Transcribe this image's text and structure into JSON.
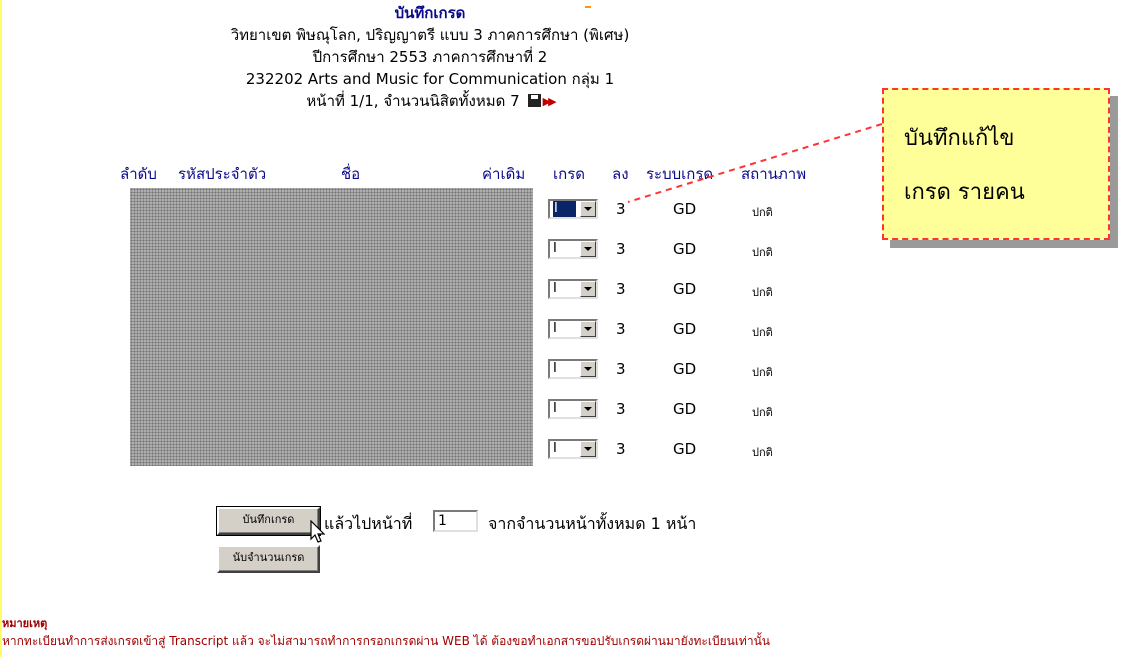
{
  "header": {
    "title": "บันทึกเกรด",
    "line1": "วิทยาเขต พิษณุโลก, ปริญญาตรี แบบ 3 ภาคการศึกษา (พิเศษ)",
    "line2": "ปีการศึกษา 2553 ภาคการศึกษาที่ 2",
    "line3": "232202 Arts and Music for Communication   กลุ่ม  1",
    "line4": "หน้าที่ 1/1, จำนวนนิสิตทั้งหมด 7",
    "icons": [
      "save-disk-icon",
      "next-page-icon"
    ]
  },
  "columns": {
    "order": "ลำดับ",
    "student_id": "รหัสประจำตัว",
    "name": "ชื่อ",
    "old_value": "ค่าเดิม",
    "grade": "เกรด",
    "credit": "ลง",
    "grade_system": "ระบบเกรด",
    "status": "สถานภาพ"
  },
  "rows": [
    {
      "grade": "I",
      "credit": "3",
      "system": "GD",
      "status": "ปกติ"
    },
    {
      "grade": "I",
      "credit": "3",
      "system": "GD",
      "status": "ปกติ"
    },
    {
      "grade": "I",
      "credit": "3",
      "system": "GD",
      "status": "ปกติ"
    },
    {
      "grade": "I",
      "credit": "3",
      "system": "GD",
      "status": "ปกติ"
    },
    {
      "grade": "I",
      "credit": "3",
      "system": "GD",
      "status": "ปกติ"
    },
    {
      "grade": "I",
      "credit": "3",
      "system": "GD",
      "status": "ปกติ"
    },
    {
      "grade": "I",
      "credit": "3",
      "system": "GD",
      "status": "ปกติ"
    }
  ],
  "callout": {
    "line1": "บันทึกแก้ไข",
    "line2": "เกรด รายคน"
  },
  "footer": {
    "save_button": "บันทึกเกรด",
    "after_text": "แล้วไปหน้าที่",
    "page_value": "1",
    "total_text": "จากจำนวนหน้าทั้งหมด 1 หน้า",
    "count_button": "นับจำนวนเกรด"
  },
  "note": {
    "title": "หมายเหตุ",
    "text": "หากทะเบียนทำการส่งเกรดเข้าสู่ Transcript แล้ว จะไม่สามารถทำการกรอกเกรดผ่าน WEB ได้ ต้องขอทำเอกสารขอปรับเกรดผ่านมายังทะเบียนเท่านั้น"
  },
  "colors": {
    "heading_blue": "#0a0a8a",
    "callout_bg": "#ffff99",
    "callout_border": "#ff3333",
    "note_red": "#a00000"
  }
}
